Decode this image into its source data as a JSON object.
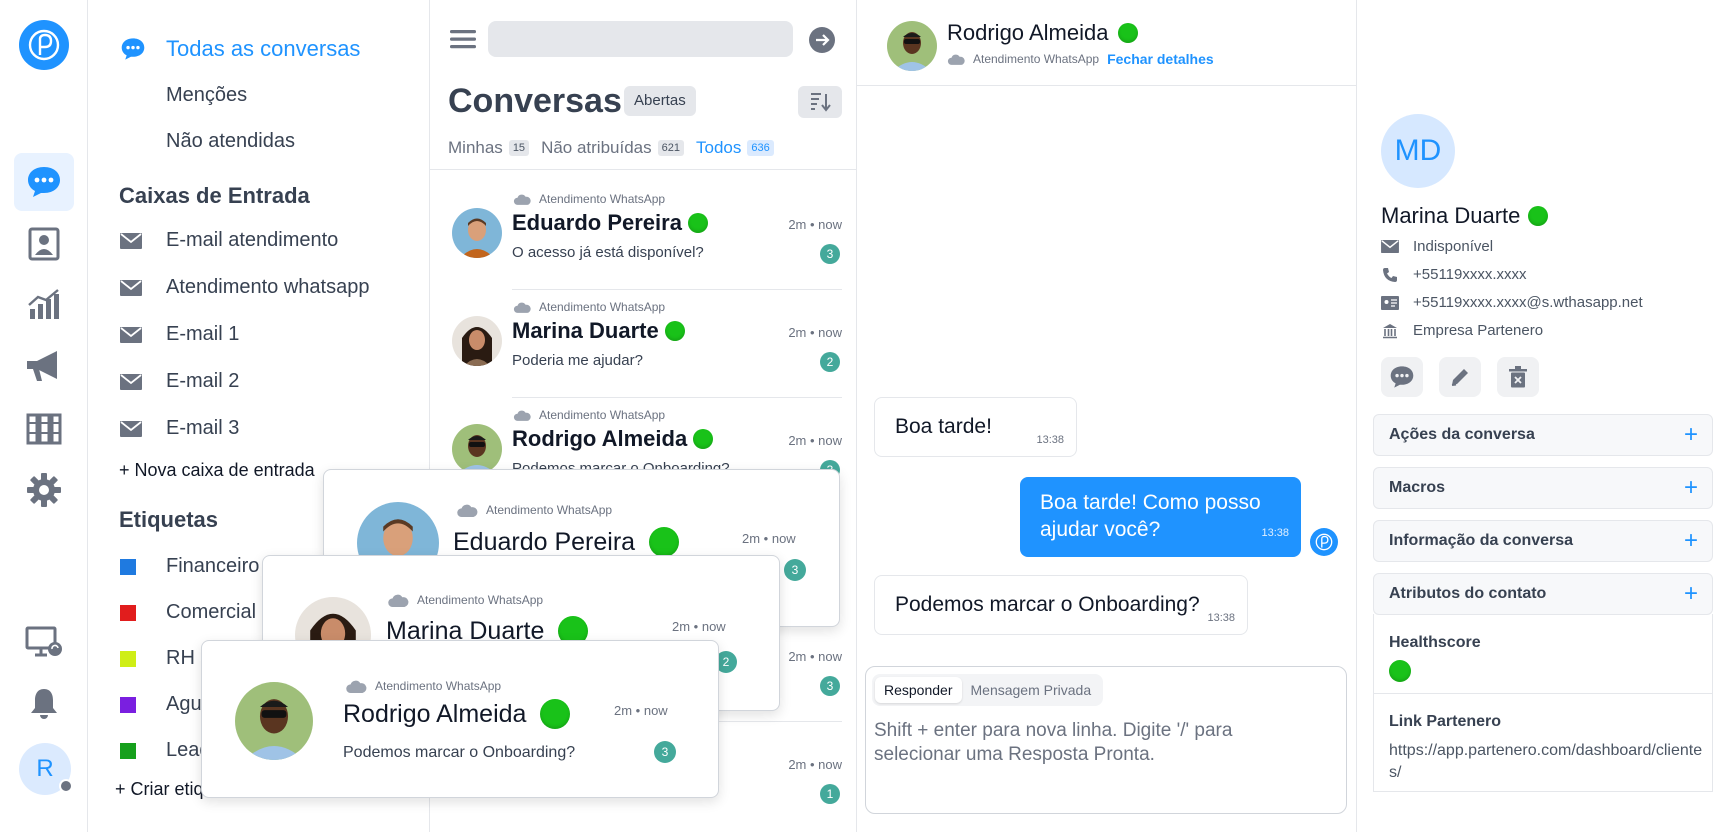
{
  "sidebar": {
    "main_items": [
      {
        "label": "Todas as conversas",
        "icon": "chat-bubble-icon",
        "active": true
      },
      {
        "label": "Menções"
      },
      {
        "label": "Não atendidas"
      }
    ],
    "inboxes_heading": "Caixas de Entrada",
    "inboxes": [
      {
        "label": "E-mail atendimento",
        "icon": "envelope-icon"
      },
      {
        "label": "Atendimento whatsapp",
        "icon": "envelope-icon"
      },
      {
        "label": "E-mail 1",
        "icon": "envelope-icon"
      },
      {
        "label": "E-mail 2",
        "icon": "envelope-icon"
      },
      {
        "label": "E-mail 3",
        "icon": "envelope-icon"
      }
    ],
    "new_inbox": "+ Nova caixa de entrada",
    "labels_heading": "Etiquetas",
    "labels": [
      {
        "label": "Financeiro",
        "color": "#1f7ae0"
      },
      {
        "label": "Comercial",
        "color": "#e11d1d"
      },
      {
        "label": "RH",
        "color": "#cfee16"
      },
      {
        "label": "Agu",
        "color": "#7a1fe0"
      },
      {
        "label": "Lead",
        "color": "#16a01c"
      }
    ],
    "create_label": "+ Criar etiq"
  },
  "rail": {
    "user_initial": "R"
  },
  "list": {
    "title": "Conversas",
    "status": "Abertas",
    "tabs": [
      {
        "label": "Minhas",
        "count": "15"
      },
      {
        "label": "Não atribuídas",
        "count": "621"
      },
      {
        "label": "Todos",
        "count": "636",
        "active": true
      }
    ],
    "conversations": [
      {
        "inbox": "Atendimento WhatsApp",
        "name": "Eduardo Pereira",
        "message": "O acesso já está disponível?",
        "time": "2m  •  now",
        "unread": "3"
      },
      {
        "inbox": "Atendimento WhatsApp",
        "name": "Marina Duarte",
        "message": "Poderia me ajudar?",
        "time": "2m  •  now",
        "unread": "2"
      },
      {
        "inbox": "Atendimento WhatsApp",
        "name": "Rodrigo Almeida",
        "message": "Podemos marcar o Onboarding?",
        "time": "2m  •  now",
        "unread": "3"
      },
      {
        "inbox": "",
        "name": "",
        "message": "",
        "time": "2m  •  now",
        "unread": "3"
      },
      {
        "inbox": "",
        "name": "",
        "message": "",
        "time": "2m  •  now",
        "unread": "1"
      }
    ]
  },
  "chat": {
    "contact_name": "Rodrigo Almeida",
    "inbox": "Atendimento WhatsApp",
    "close_details": "Fechar detalhes",
    "messages": [
      {
        "text": "Boa tarde!",
        "time": "13:38",
        "direction": "in"
      },
      {
        "text": "Boa tarde! Como posso ajudar você?",
        "time": "13:38",
        "direction": "out"
      },
      {
        "text": "Podemos marcar o Onboarding?",
        "time": "13:38",
        "direction": "in"
      }
    ],
    "composer": {
      "tab_reply": "Responder",
      "tab_private": "Mensagem Privada",
      "placeholder": "Shift + enter para nova linha. Digite '/' para selecionar uma Resposta Pronta."
    }
  },
  "details": {
    "initials": "MD",
    "name": "Marina Duarte",
    "email": "Indisponível",
    "phone": "+55119xxxx.xxxx",
    "identifier": "+55119xxxx.xxxx@s.wthasapp.net",
    "company": "Empresa Partenero",
    "accordions": [
      "Ações da conversa",
      "Macros",
      "Informação da conversa",
      "Atributos do contato"
    ],
    "attributes": {
      "healthscore_label": "Healthscore",
      "link_label": "Link Partenero",
      "link_value": "https://app.partenero.com/dashboard/clientes/"
    }
  },
  "notifications": [
    {
      "inbox": "Atendimento WhatsApp",
      "name": "Eduardo Pereira",
      "time": "2m  •  now",
      "unread": "3",
      "message": ""
    },
    {
      "inbox": "Atendimento WhatsApp",
      "name": "Marina Duarte",
      "time": "2m  •  now",
      "unread": "2",
      "message": ""
    },
    {
      "inbox": "Atendimento WhatsApp",
      "name": "Rodrigo Almeida",
      "time": "2m  •  now",
      "unread": "3",
      "message": "Podemos marcar o Onboarding?"
    }
  ],
  "colors": {
    "accent": "#1f93ff",
    "online": "#19c219",
    "badge": "#44a99b"
  }
}
